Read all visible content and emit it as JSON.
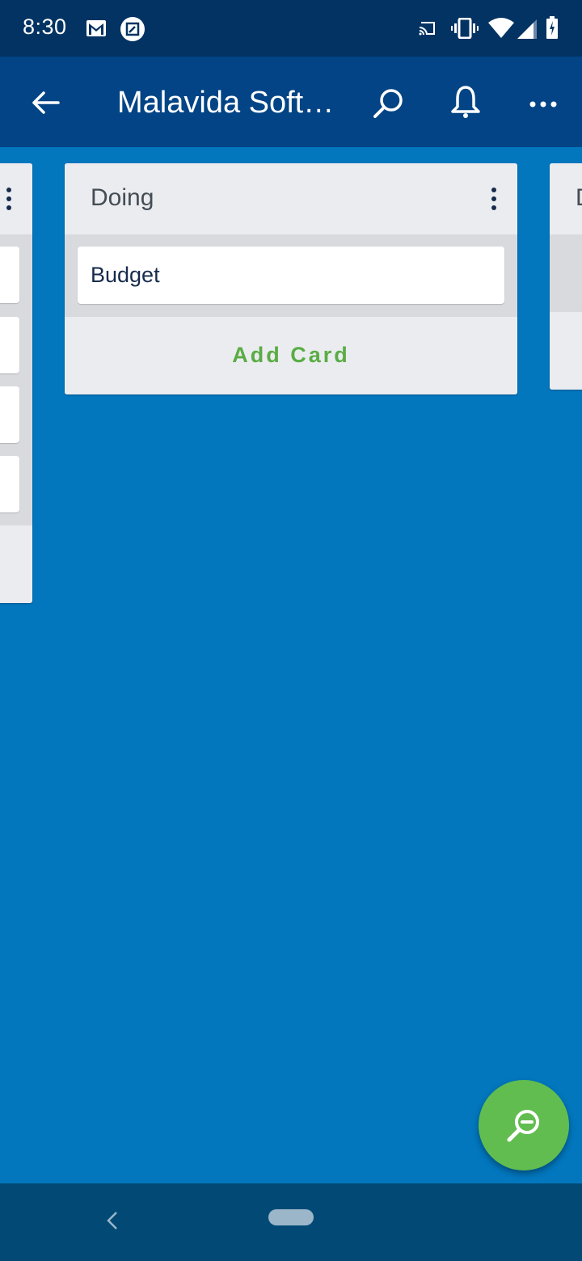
{
  "status_bar": {
    "time": "8:30",
    "left_icons": [
      "gmail-icon",
      "screenshot-edit-icon"
    ],
    "right_icons": [
      "cast-icon",
      "vibrate-icon",
      "wifi-icon",
      "signal-icon",
      "battery-charging-icon"
    ]
  },
  "app_bar": {
    "back_icon": "arrow-left-icon",
    "title": "Malavida Soft…",
    "actions": [
      "search-icon",
      "bell-icon",
      "more-horizontal-icon"
    ]
  },
  "board": {
    "lists": [
      {
        "title": "",
        "cards": [
          "",
          "",
          "",
          ""
        ],
        "partially_visible": "left"
      },
      {
        "title": "Doing",
        "cards": [
          "Budget"
        ],
        "add_card_label": "Add Card"
      },
      {
        "title": "D",
        "cards": [],
        "partially_visible": "right"
      }
    ]
  },
  "fab": {
    "icon": "zoom-out-icon",
    "color": "#61bd4f"
  },
  "nav_bar": {
    "back_icon": "chevron-left-icon",
    "home_icon": "home-pill-icon"
  },
  "colors": {
    "status_bar": "#023363",
    "app_bar": "#024485",
    "board_background": "#0277be",
    "list_background": "#ebecf0",
    "add_card_text": "#5aac44"
  }
}
